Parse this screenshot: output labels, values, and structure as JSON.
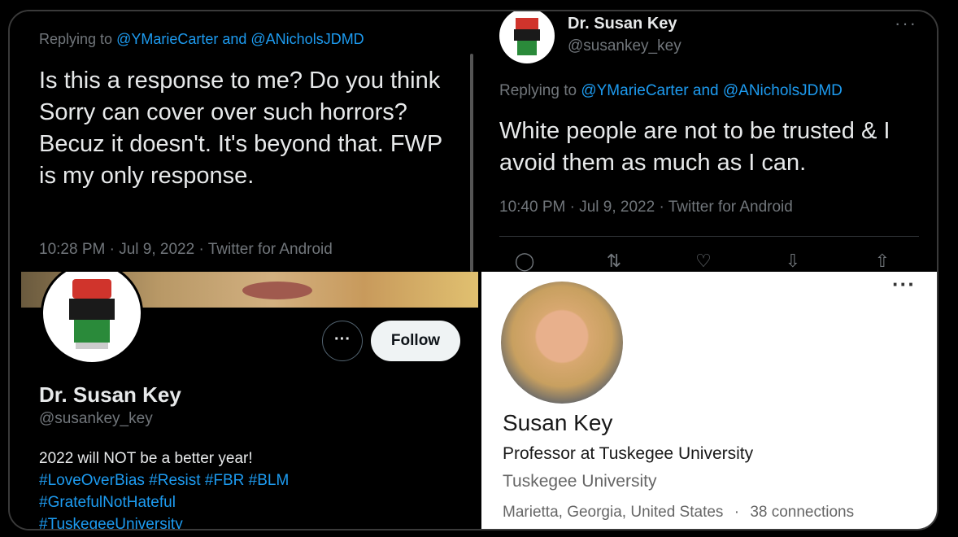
{
  "tweet_reply": {
    "replying_prefix": "Replying to ",
    "replying_to": "@YMarieCarter and @ANicholsJDMD",
    "text": "Is this a response to me? Do you think Sorry can cover over such horrors? Becuz it doesn't. It's beyond that. FWP is my only response.",
    "meta": "10:28 PM · Jul 9, 2022 · Twitter for Android"
  },
  "tweet_main": {
    "name": "Dr. Susan Key",
    "handle": "@susankey_key",
    "more": "···",
    "replying_prefix": "Replying to ",
    "replying_to": "@YMarieCarter and @ANicholsJDMD",
    "text": "White people are not to be trusted & I avoid them as much as I can.",
    "meta": "10:40 PM · Jul 9, 2022 · Twitter for Android",
    "actions": [
      {
        "icon": "reply-icon",
        "glyph": "◯"
      },
      {
        "icon": "retweet-icon",
        "glyph": "⇅"
      },
      {
        "icon": "like-icon",
        "glyph": "♡"
      },
      {
        "icon": "bookmark-icon",
        "glyph": "⇩"
      },
      {
        "icon": "share-icon",
        "glyph": "⇧"
      }
    ]
  },
  "twitter_profile": {
    "more_label": "···",
    "follow_label": "Follow",
    "name": "Dr. Susan Key",
    "handle": "@susankey_key",
    "bio_line1": "2022 will NOT be a better year!",
    "bio_tags1": "#LoveOverBias #Resist #FBR #BLM",
    "bio_tags2": "#GratefulNotHateful",
    "bio_tags3": "#TuskegeeUniversity"
  },
  "linkedin_profile": {
    "more": "···",
    "name": "Susan Key",
    "headline": "Professor at Tuskegee University",
    "company": "Tuskegee University",
    "location": "Marietta, Georgia, United States",
    "separator": "·",
    "connections": "38 connections"
  },
  "colors": {
    "link": "#1d9bf0",
    "muted": "#71767b",
    "text": "#e7e9ea",
    "fist_red": "#d0342c",
    "fist_black": "#1a1a1a",
    "fist_green": "#2a8a3a"
  }
}
